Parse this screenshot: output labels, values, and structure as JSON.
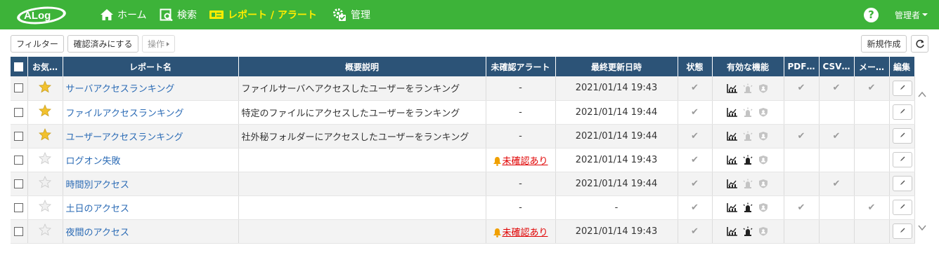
{
  "brand": {
    "logo_text": "ALog",
    "nav_bg": "#3db339",
    "header_bg": "#2c5377",
    "active_color": "#ffec00"
  },
  "nav": [
    {
      "label": "ホーム",
      "icon": "home-icon"
    },
    {
      "label": "検索",
      "icon": "search-doc-icon"
    },
    {
      "label": "レポート / アラート",
      "icon": "report-icon",
      "active": true
    },
    {
      "label": "管理",
      "icon": "gear-check-icon"
    }
  ],
  "header": {
    "help_label": "?",
    "user_label": "管理者"
  },
  "toolbar": {
    "filter_label": "フィルター",
    "confirm_label": "確認済みにする",
    "ops_label": "操作",
    "new_label": "新規作成"
  },
  "table": {
    "columns": [
      "お気…",
      "レポート名",
      "概要説明",
      "未確認アラート",
      "最終更新日時",
      "状態",
      "有効な機能",
      "PDF…",
      "CSV…",
      "メー…",
      "編集"
    ],
    "rows": [
      {
        "fav": true,
        "name": "サーバアクセスランキング",
        "desc": "ファイルサーバへアクセスしたユーザーをランキング",
        "alert": "-",
        "alert_flag": false,
        "updated": "2021/01/14 19:43",
        "status": "✔",
        "f1": true,
        "f2": false,
        "f3": false,
        "pdf": "✔",
        "csv": "✔",
        "mail": "✔"
      },
      {
        "fav": true,
        "name": "ファイルアクセスランキング",
        "desc": "特定のファイルにアクセスしたユーザーをランキング",
        "alert": "-",
        "alert_flag": false,
        "updated": "2021/01/14 19:44",
        "status": "✔",
        "f1": true,
        "f2": false,
        "f3": false,
        "pdf": "",
        "csv": "",
        "mail": ""
      },
      {
        "fav": true,
        "name": "ユーザーアクセスランキング",
        "desc": "社外秘フォルダーにアクセスしたユーザーをランキング",
        "alert": "-",
        "alert_flag": false,
        "updated": "2021/01/14 19:44",
        "status": "✔",
        "f1": true,
        "f2": false,
        "f3": false,
        "pdf": "✔",
        "csv": "✔",
        "mail": ""
      },
      {
        "fav": false,
        "name": "ログオン失敗",
        "desc": "",
        "alert": "未確認あり",
        "alert_flag": true,
        "updated": "2021/01/14 19:43",
        "status": "✔",
        "f1": true,
        "f2": true,
        "f3": false,
        "pdf": "",
        "csv": "",
        "mail": ""
      },
      {
        "fav": false,
        "name": "時間別アクセス",
        "desc": "",
        "alert": "-",
        "alert_flag": false,
        "updated": "2021/01/14 19:44",
        "status": "✔",
        "f1": true,
        "f2": false,
        "f3": false,
        "pdf": "",
        "csv": "✔",
        "mail": ""
      },
      {
        "fav": false,
        "name": "土日のアクセス",
        "desc": "",
        "alert": "-",
        "alert_flag": false,
        "updated": "-",
        "status": "✔",
        "f1": true,
        "f2": true,
        "f3": false,
        "pdf": "✔",
        "csv": "",
        "mail": "✔"
      },
      {
        "fav": false,
        "name": "夜間のアクセス",
        "desc": "",
        "alert": "未確認あり",
        "alert_flag": true,
        "updated": "2021/01/14 19:43",
        "status": "✔",
        "f1": true,
        "f2": true,
        "f3": false,
        "pdf": "",
        "csv": "",
        "mail": ""
      }
    ]
  }
}
